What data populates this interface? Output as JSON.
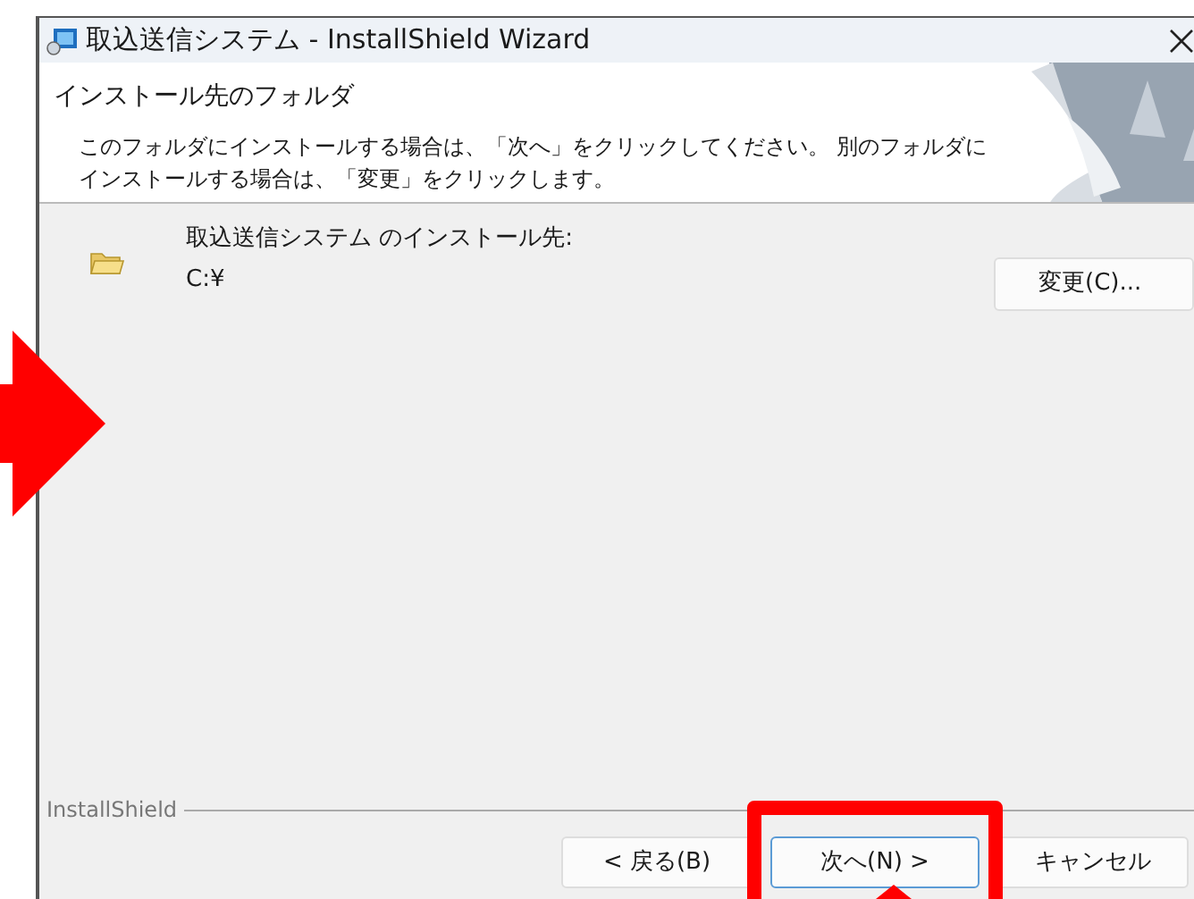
{
  "window": {
    "title": "取込送信システム - InstallShield Wizard"
  },
  "header": {
    "title": "インストール先のフォルダ",
    "description_lines": [
      "このフォルダにインストールする場合は、「次へ」をクリックしてください。 別のフォルダに",
      "インストールする場合は、「変更」をクリックします。"
    ]
  },
  "destination": {
    "label": "取込送信システム のインストール先:",
    "path": "C:¥",
    "change_button": "変更(C)..."
  },
  "brand": "InstallShield",
  "buttons": [
    {
      "label": "< 戻る(B)",
      "selected": false
    },
    {
      "label": "次へ(N) >",
      "selected": true
    },
    {
      "label": "キャンセル",
      "selected": false
    }
  ]
}
